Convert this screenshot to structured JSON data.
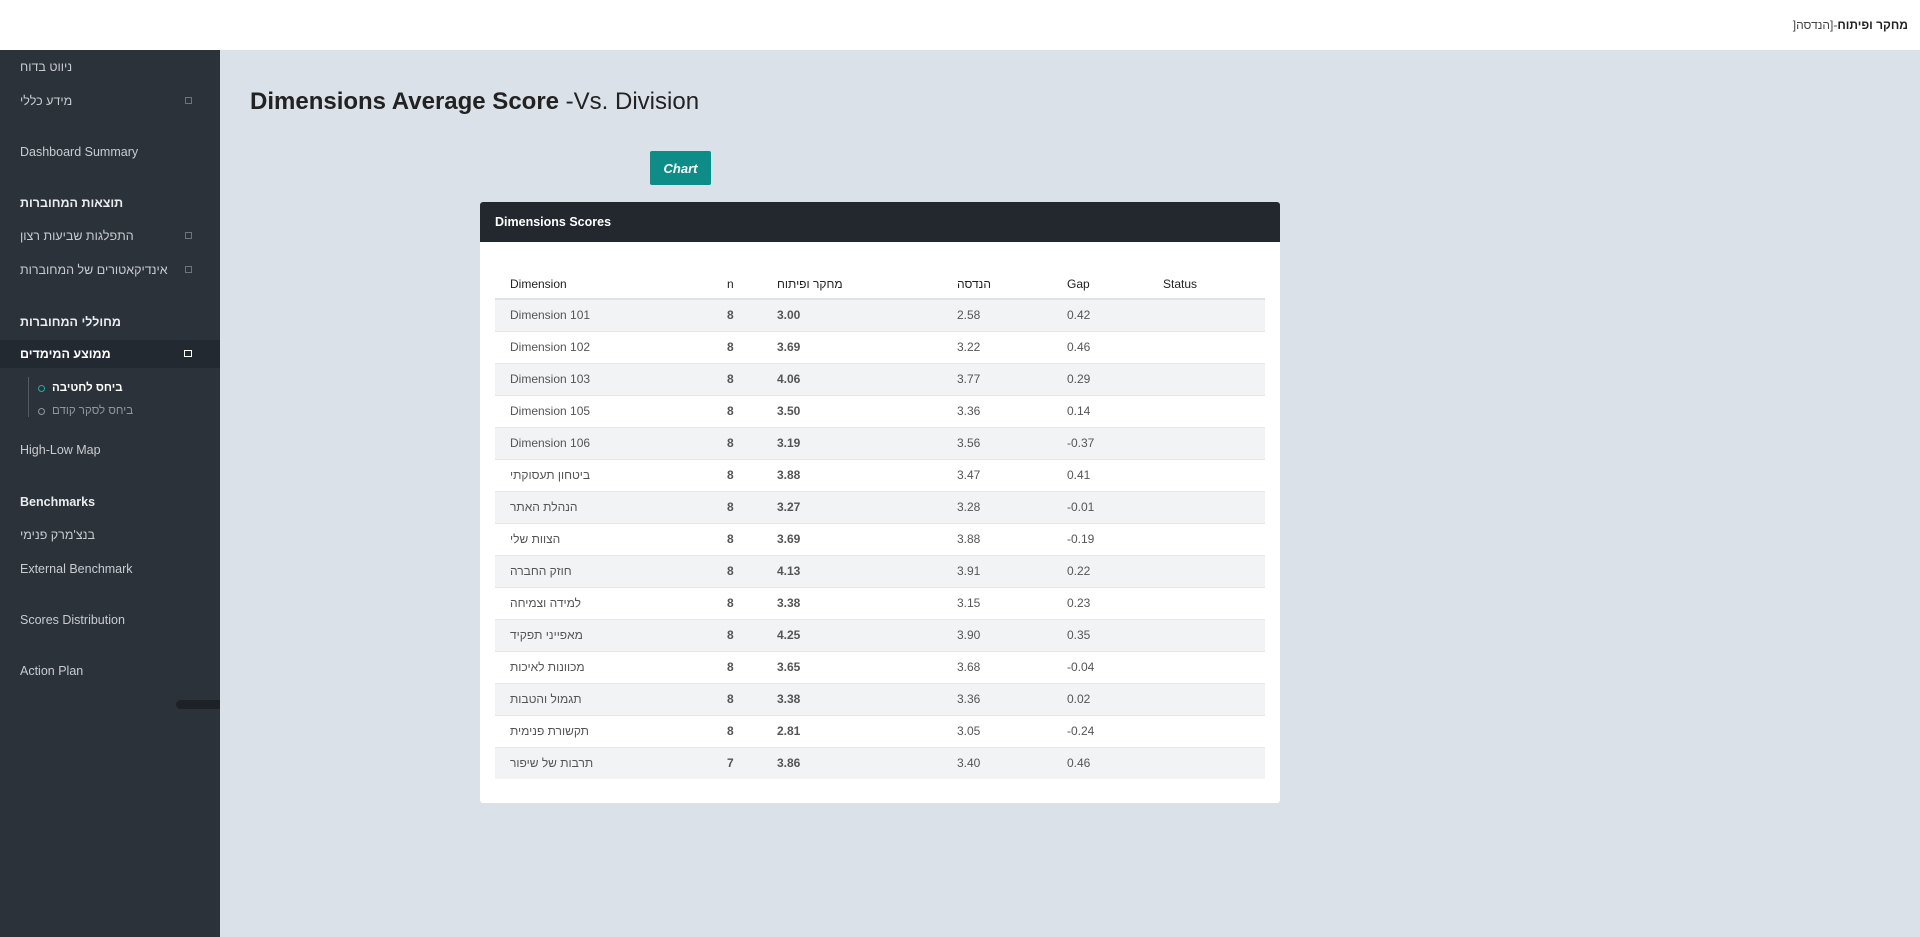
{
  "topbar": {
    "context_prefix": "]",
    "context_bold": "מחקר ופיתוח",
    "context_rest": "-[הנדסה"
  },
  "sidebar": {
    "items": [
      {
        "label": "ניווט בדוח",
        "type": "item"
      },
      {
        "label": "מידע כללי",
        "type": "item",
        "expandable": true
      },
      {
        "label": "Dashboard Summary",
        "type": "item"
      },
      {
        "label": "תוצאות המחוברות",
        "type": "header"
      },
      {
        "label": "התפלגות שביעות רצון",
        "type": "item",
        "expandable": true
      },
      {
        "label": "אינדיקאטורים של המחוברות",
        "type": "item",
        "expandable": true
      },
      {
        "label": "מחוללי המחוברות",
        "type": "header"
      },
      {
        "label": "ממוצע המימדים",
        "type": "item",
        "expandable": true,
        "active": true
      },
      {
        "label": "High-Low Map",
        "type": "item"
      },
      {
        "label": "Benchmarks",
        "type": "header"
      },
      {
        "label": "בנצ'מרק פנימי",
        "type": "item"
      },
      {
        "label": "External Benchmark",
        "type": "item"
      },
      {
        "label": "Scores Distribution",
        "type": "item"
      },
      {
        "label": "Action Plan",
        "type": "item"
      }
    ],
    "subitems": [
      {
        "label": "ביחס לחטיבה",
        "current": true
      },
      {
        "label": "ביחס לסקר קודם",
        "current": false
      }
    ]
  },
  "page": {
    "title_bold": "Dimensions Average Score",
    "title_rest": " -Vs. Division"
  },
  "chart_button": {
    "label": "Chart"
  },
  "card": {
    "title": "Dimensions Scores",
    "columns": [
      "Dimension",
      "n",
      "מחקר ופיתוח",
      "הנדסה",
      "Gap",
      "Status"
    ],
    "rows": [
      [
        "Dimension 101",
        "8",
        "3.00",
        "2.58",
        "0.42",
        ""
      ],
      [
        "Dimension 102",
        "8",
        "3.69",
        "3.22",
        "0.46",
        ""
      ],
      [
        "Dimension 103",
        "8",
        "4.06",
        "3.77",
        "0.29",
        ""
      ],
      [
        "Dimension 105",
        "8",
        "3.50",
        "3.36",
        "0.14",
        ""
      ],
      [
        "Dimension 106",
        "8",
        "3.19",
        "3.56",
        "-0.37",
        ""
      ],
      [
        "ביטחון תעסוקתי",
        "8",
        "3.88",
        "3.47",
        "0.41",
        ""
      ],
      [
        "הנהלת האתר",
        "8",
        "3.27",
        "3.28",
        "-0.01",
        ""
      ],
      [
        "הצוות שלי",
        "8",
        "3.69",
        "3.88",
        "-0.19",
        ""
      ],
      [
        "חוזק החברה",
        "8",
        "4.13",
        "3.91",
        "0.22",
        ""
      ],
      [
        "למידה וצמיחה",
        "8",
        "3.38",
        "3.15",
        "0.23",
        ""
      ],
      [
        "מאפייני תפקיד",
        "8",
        "4.25",
        "3.90",
        "0.35",
        ""
      ],
      [
        "מכוונות לאיכות",
        "8",
        "3.65",
        "3.68",
        "-0.04",
        ""
      ],
      [
        "תגמול והטבות",
        "8",
        "3.38",
        "3.36",
        "0.02",
        ""
      ],
      [
        "תקשורת פנימית",
        "8",
        "2.81",
        "3.05",
        "-0.24",
        ""
      ],
      [
        "תרבות של שיפור",
        "7",
        "3.86",
        "3.40",
        "0.46",
        ""
      ]
    ]
  },
  "colors": {
    "accent": "#0e8c87",
    "sidebar_bg": "#2b3239",
    "page_bg": "#dbe1e9",
    "card_header_bg": "#23282e"
  }
}
